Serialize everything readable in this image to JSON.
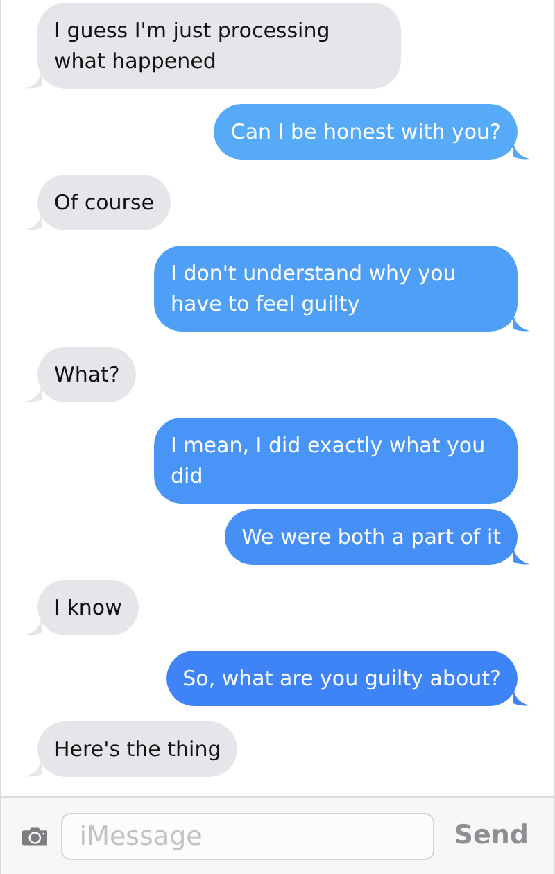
{
  "messages": [
    {
      "kind": "received",
      "text": "I guess I'm just processing what happened"
    },
    {
      "kind": "sent",
      "text": "Can I be honest with you?"
    },
    {
      "kind": "received",
      "text": "Of course"
    },
    {
      "kind": "sent",
      "text": "I don't understand why you have to feel guilty"
    },
    {
      "kind": "received",
      "text": "What?"
    },
    {
      "kind": "sent",
      "text": "I mean, I did exactly what you did"
    },
    {
      "kind": "sent",
      "text": "We were both a part of it"
    },
    {
      "kind": "received",
      "text": "I know"
    },
    {
      "kind": "sent",
      "text": "So, what are you guilty about?"
    },
    {
      "kind": "received",
      "text": "Here's the thing"
    }
  ],
  "composer": {
    "placeholder": "iMessage",
    "send": "Send"
  }
}
